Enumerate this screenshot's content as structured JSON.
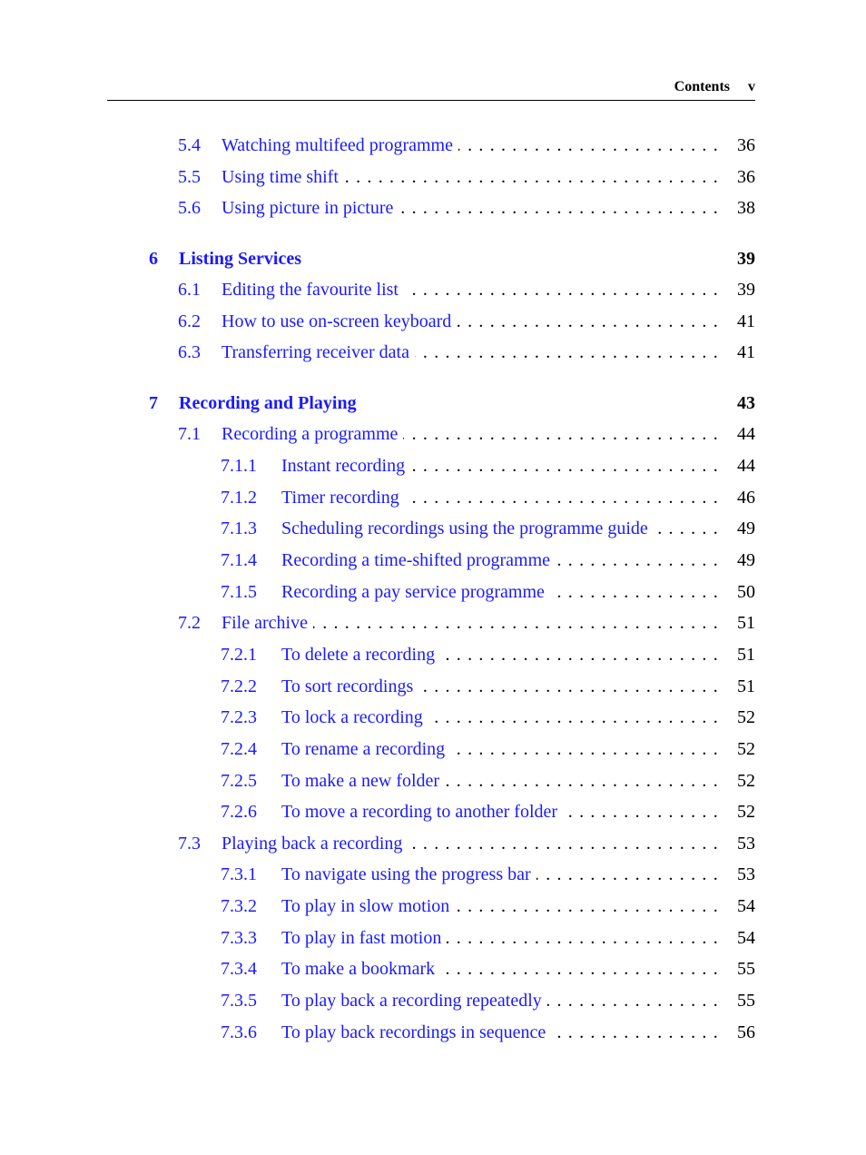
{
  "header": {
    "title": "Contents",
    "page": "v"
  },
  "entries": [
    {
      "level": 1,
      "number": "5.4",
      "title": "Watching multifeed programme",
      "page": "36"
    },
    {
      "level": 1,
      "number": "5.5",
      "title": "Using time shift",
      "page": "36"
    },
    {
      "level": 1,
      "number": "5.6",
      "title": "Using picture in picture",
      "page": "38"
    },
    {
      "level": 0,
      "number": "6",
      "title": "Listing Services",
      "page": "39"
    },
    {
      "level": 1,
      "number": "6.1",
      "title": "Editing the favourite list",
      "page": "39"
    },
    {
      "level": 1,
      "number": "6.2",
      "title": "How to use on-screen keyboard",
      "page": "41"
    },
    {
      "level": 1,
      "number": "6.3",
      "title": "Transferring receiver data",
      "page": "41"
    },
    {
      "level": 0,
      "number": "7",
      "title": "Recording and Playing",
      "page": "43"
    },
    {
      "level": 1,
      "number": "7.1",
      "title": "Recording a programme",
      "page": "44"
    },
    {
      "level": 2,
      "number": "7.1.1",
      "title": "Instant recording",
      "page": "44"
    },
    {
      "level": 2,
      "number": "7.1.2",
      "title": "Timer recording",
      "page": "46"
    },
    {
      "level": 2,
      "number": "7.1.3",
      "title": "Scheduling recordings using the programme guide",
      "page": "49"
    },
    {
      "level": 2,
      "number": "7.1.4",
      "title": "Recording a time-shifted programme",
      "page": "49"
    },
    {
      "level": 2,
      "number": "7.1.5",
      "title": "Recording a pay service programme",
      "page": "50"
    },
    {
      "level": 1,
      "number": "7.2",
      "title": "File archive",
      "page": "51"
    },
    {
      "level": 2,
      "number": "7.2.1",
      "title": "To delete a recording",
      "page": "51"
    },
    {
      "level": 2,
      "number": "7.2.2",
      "title": "To sort recordings",
      "page": "51"
    },
    {
      "level": 2,
      "number": "7.2.3",
      "title": "To lock a recording",
      "page": "52"
    },
    {
      "level": 2,
      "number": "7.2.4",
      "title": "To rename a recording",
      "page": "52"
    },
    {
      "level": 2,
      "number": "7.2.5",
      "title": "To make a new folder",
      "page": "52"
    },
    {
      "level": 2,
      "number": "7.2.6",
      "title": "To move a recording to another folder",
      "page": "52"
    },
    {
      "level": 1,
      "number": "7.3",
      "title": "Playing back a recording",
      "page": "53"
    },
    {
      "level": 2,
      "number": "7.3.1",
      "title": "To navigate using the progress bar",
      "page": "53"
    },
    {
      "level": 2,
      "number": "7.3.2",
      "title": "To play in slow motion",
      "page": "54"
    },
    {
      "level": 2,
      "number": "7.3.3",
      "title": "To play in fast motion",
      "page": "54"
    },
    {
      "level": 2,
      "number": "7.3.4",
      "title": "To make a bookmark",
      "page": "55"
    },
    {
      "level": 2,
      "number": "7.3.5",
      "title": "To play back a recording repeatedly",
      "page": "55"
    },
    {
      "level": 2,
      "number": "7.3.6",
      "title": "To play back recordings in sequence",
      "page": "56"
    }
  ]
}
